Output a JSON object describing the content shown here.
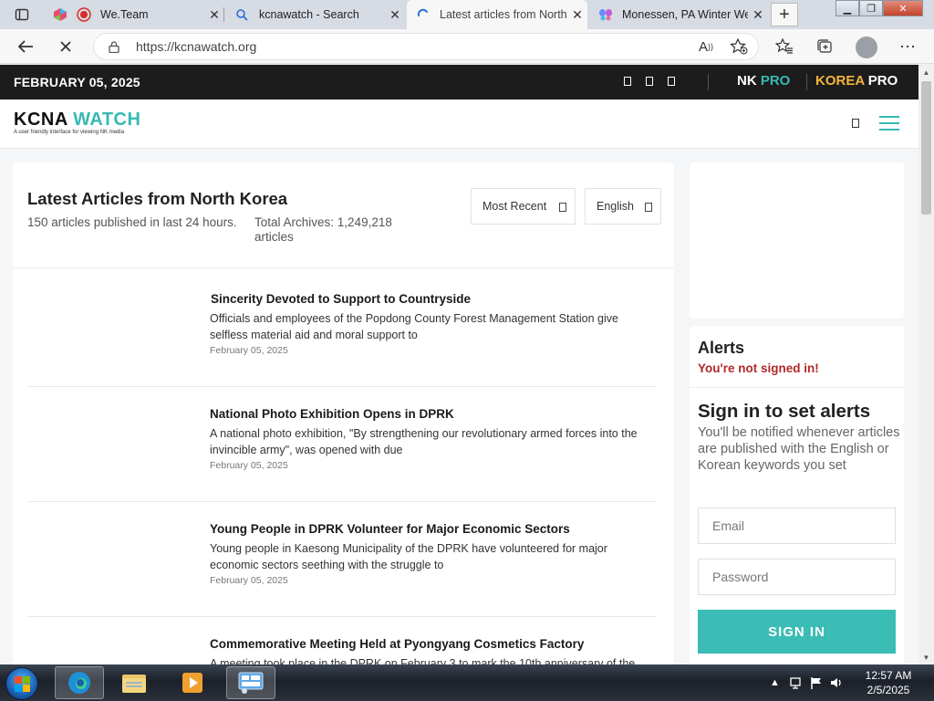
{
  "browser": {
    "tabs": [
      {
        "title": "We.Team"
      },
      {
        "title": "kcnawatch - Search"
      },
      {
        "title": "Latest articles from North"
      },
      {
        "title": "Monessen, PA Winter We"
      }
    ],
    "url": "https://kcnawatch.org"
  },
  "site": {
    "date": "FEBRUARY 05, 2025",
    "nk_pro": {
      "a": "NK",
      "b": "PRO"
    },
    "korea_pro": {
      "a": "KOREA",
      "b": "PRO"
    },
    "logo": {
      "a": "KCNA",
      "b": "WATCH",
      "tagline": "A user friendly interface for viewing NK media"
    }
  },
  "main": {
    "title": "Latest Articles from North Korea",
    "stat_24h": "150 articles published in last 24 hours.",
    "stat_archives": "Total Archives: 1,249,218 articles",
    "sort": "Most Recent",
    "language": "English",
    "articles": [
      {
        "title": "Sincerity Devoted to Support to Countryside",
        "desc": "Officials and employees of the Popdong County Forest Management Station give selfless material aid and moral support to",
        "date": "February 05, 2025"
      },
      {
        "title": "National Photo Exhibition Opens in DPRK",
        "desc": "A national photo exhibition, \"By strengthening our revolutionary armed forces into the invincible army\", was opened with due",
        "date": "February 05, 2025"
      },
      {
        "title": "Young People in DPRK Volunteer for Major Economic Sectors",
        "desc": "Young people in Kaesong Municipality of the DPRK have volunteered for major economic sectors seething with the struggle to",
        "date": "February 05, 2025"
      },
      {
        "title": "Commemorative Meeting Held at Pyongyang Cosmetics Factory",
        "desc": "A meeting took place in the DPRK on February 3 to mark the 10th anniversary of the",
        "date": ""
      }
    ]
  },
  "alerts": {
    "title": "Alerts",
    "warning": "You're not signed in!",
    "signin_title": "Sign in to set alerts",
    "signin_desc": "You'll be notified whenever articles are published with the English or Korean keywords you set",
    "email_placeholder": "Email",
    "password_placeholder": "Password",
    "button": "SIGN IN"
  },
  "taskbar": {
    "time": "12:57 AM",
    "date": "2/5/2025"
  },
  "colors": {
    "accent": "#37b9b4",
    "korea_pro": "#f3b53b",
    "warning": "#b02a2a"
  }
}
